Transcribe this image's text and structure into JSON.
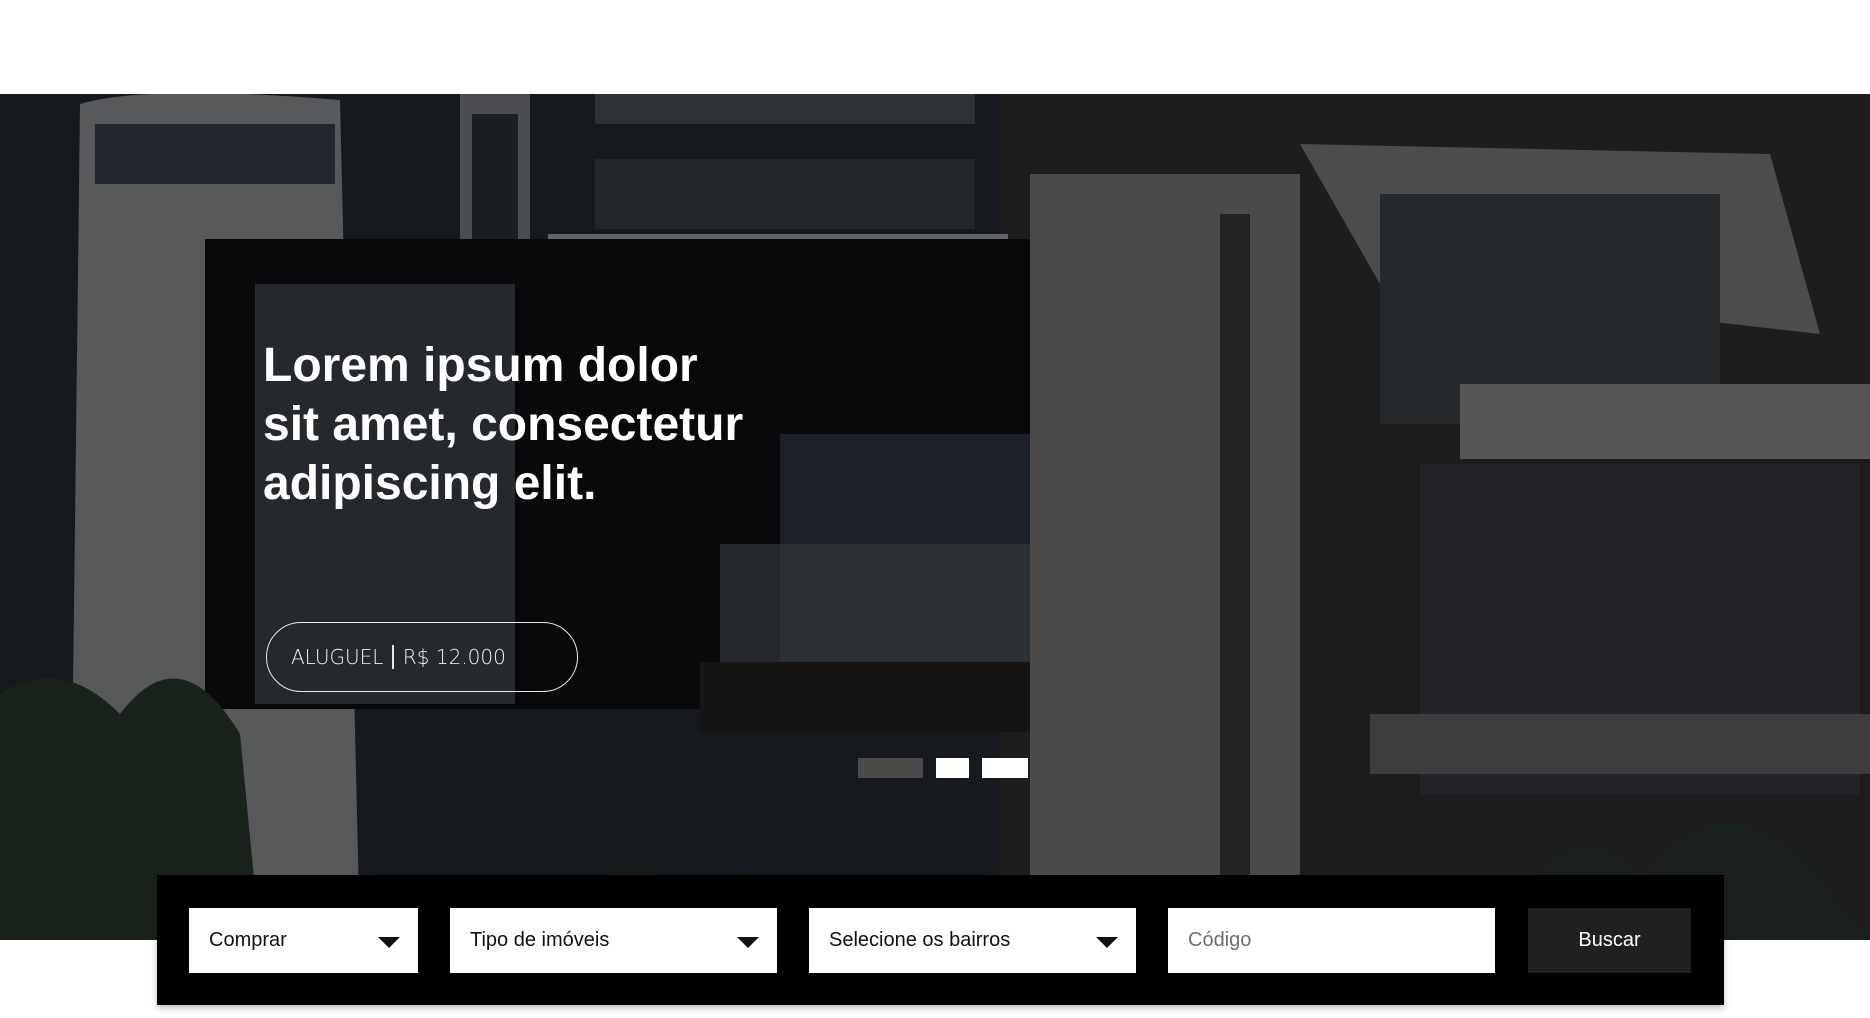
{
  "hero": {
    "headline_lines": [
      "Lorem ipsum dolor",
      "sit amet, consectetur",
      "adipiscing elit."
    ],
    "price_type": "ALUGUEL",
    "price_value": "R$ 12.000",
    "slides_total": 3,
    "active_slide": 1
  },
  "search": {
    "deal_type": "Comprar",
    "property_type": "Tipo de imóveis",
    "neighborhoods": "Selecione os bairros",
    "code_placeholder": "Código",
    "button_label": "Buscar"
  },
  "colors": {
    "page_bg": "#ffffff",
    "search_bar_bg": "#000000",
    "button_bg": "#202020",
    "dot_active": "#4b4b4b",
    "dot_inactive": "#ffffff"
  },
  "icons": {
    "dropdown": "caret-down-icon"
  }
}
